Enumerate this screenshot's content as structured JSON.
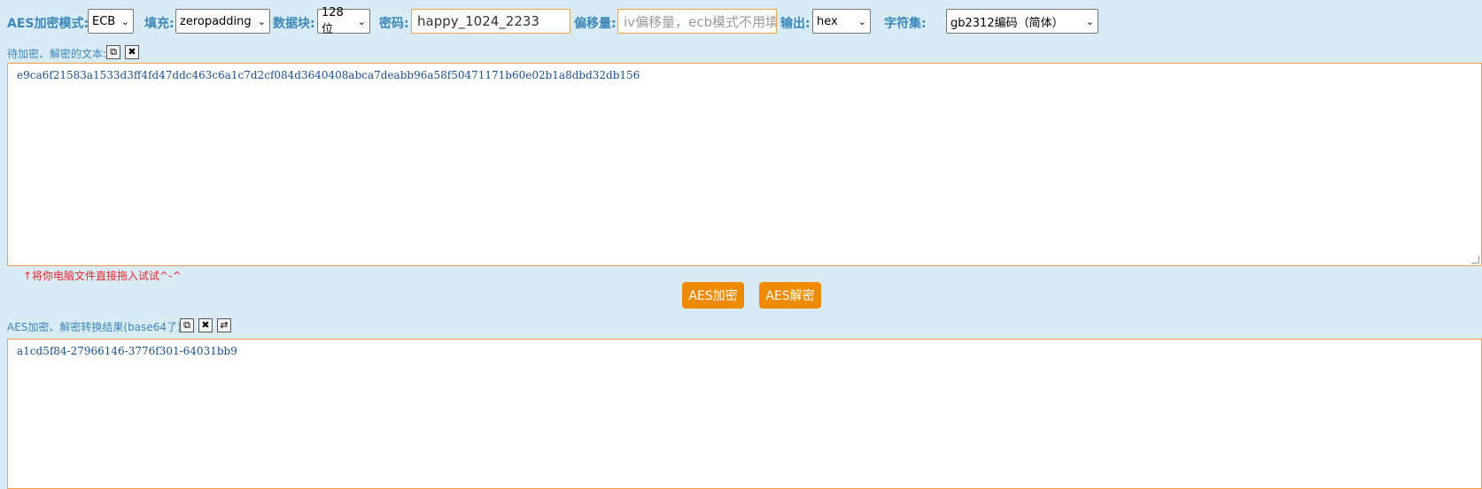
{
  "toolbar": {
    "mode_label": "AES加密模式:",
    "mode_value": "ECB",
    "padding_label": "填充:",
    "padding_value": "zeropadding",
    "block_label": "数据块:",
    "block_value": "128位",
    "password_label": "密码:",
    "password_value": "happy_1024_2233",
    "iv_label": "偏移量:",
    "iv_placeholder": "iv偏移量，ecb模式不用填",
    "output_label": "输出:",
    "output_value": "hex",
    "charset_label": "字符集:",
    "charset_value": "gb2312编码（简体）"
  },
  "input_area": {
    "label": "待加密、解密的文本:",
    "text": "e9ca6f21583a1533d3ff4fd47ddc463c6a1c7d2cf084d3640408abca7deabb96a58f50471171b60e02b1a8dbd32db156",
    "hint": "↑将你电脑文件直接拖入试试^-^"
  },
  "actions": {
    "encrypt_label": "AES加密",
    "decrypt_label": "AES解密"
  },
  "output_area": {
    "label": "AES加密、解密转换结果(base64了):",
    "text": "a1cd5f84-27966146-3776f301-64031bb9"
  },
  "icons": {
    "copy": "copy-icon",
    "clear": "close-icon",
    "swap": "swap-icon"
  },
  "colors": {
    "background": "#d9ecf5",
    "label": "#3b87b8",
    "accent_border": "#f0a04b",
    "button": "#f08a00",
    "hint": "#e8272c",
    "text": "#1a4f8a"
  }
}
